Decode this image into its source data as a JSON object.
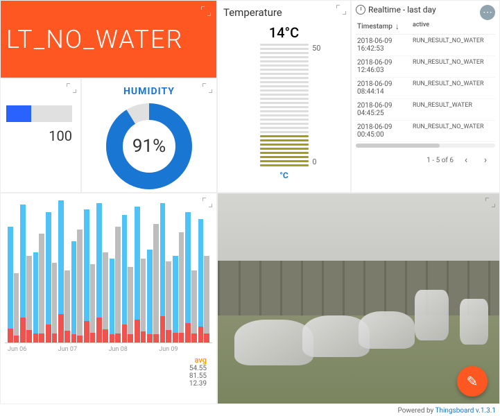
{
  "banner": {
    "text": "LT_NO_WATER"
  },
  "bar": {
    "max": "100"
  },
  "humidity": {
    "title": "HUMIDITY",
    "value": "91%",
    "percent": 91
  },
  "temperature": {
    "title": "Temperature",
    "value": "14°C",
    "max": "50",
    "min": "0",
    "unit": "°C"
  },
  "realtime": {
    "title": "Realtime - last day",
    "col1": "Timestamp",
    "col2": "active",
    "rows": [
      {
        "ts": "2018-06-09 16:42:53",
        "val": "RUN_RESULT_NO_WATER"
      },
      {
        "ts": "2018-06-09 12:46:03",
        "val": "RUN_RESULT_NO_WATER"
      },
      {
        "ts": "2018-06-09 08:44:14",
        "val": "RUN_RESULT_NO_WATER"
      },
      {
        "ts": "2018-06-09 04:45:25",
        "val": "RUN_RESULT_WATER"
      },
      {
        "ts": "2018-06-09 00:45:00",
        "val": "RUN_RESULT_NO_WATER"
      }
    ],
    "pager": "1 - 5 of 6"
  },
  "chart_data": {
    "type": "bar",
    "categories": [
      "Jun 06",
      "Jun 07",
      "Jun 08",
      "Jun 09"
    ],
    "series": [
      {
        "name": "blue",
        "avg": 54.55
      },
      {
        "name": "grey",
        "avg": 81.55
      },
      {
        "name": "red",
        "avg": 12.39
      }
    ],
    "bars": [
      {
        "blue": 80,
        "grey": 48,
        "red": 12
      },
      {
        "blue": 95,
        "grey": 60,
        "red": 18
      },
      {
        "blue": 62,
        "grey": 75,
        "red": 10
      },
      {
        "blue": 90,
        "grey": 55,
        "red": 14
      },
      {
        "blue": 98,
        "grey": 50,
        "red": 20
      },
      {
        "blue": 70,
        "grey": 78,
        "red": 8
      },
      {
        "blue": 92,
        "grey": 54,
        "red": 16
      },
      {
        "blue": 96,
        "grey": 62,
        "red": 18
      },
      {
        "blue": 58,
        "grey": 80,
        "red": 10
      },
      {
        "blue": 88,
        "grey": 52,
        "red": 14
      },
      {
        "blue": 94,
        "grey": 58,
        "red": 17
      },
      {
        "blue": 64,
        "grey": 82,
        "red": 9
      },
      {
        "blue": 96,
        "grey": 56,
        "red": 19
      },
      {
        "blue": 60,
        "grey": 76,
        "red": 11
      },
      {
        "blue": 90,
        "grey": 50,
        "red": 15
      },
      {
        "blue": 85,
        "grey": 60,
        "red": 13
      }
    ],
    "legend_header": "avg",
    "xlabels": [
      "Jun 06",
      "Jun 07",
      "Jun 08",
      "Jun 09"
    ]
  },
  "footer": {
    "prefix": "Powered by ",
    "link": "Thingsboard v.1.3.1"
  }
}
